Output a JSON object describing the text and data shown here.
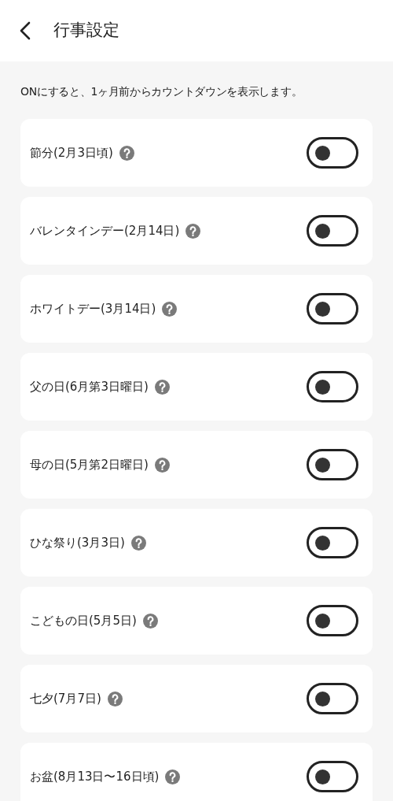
{
  "header": {
    "title": "行事設定"
  },
  "description": "ONにすると、1ヶ月前からカウントダウンを表示します。",
  "events": [
    {
      "label": "節分(2月3日頃)",
      "on": false
    },
    {
      "label": "バレンタインデー(2月14日)",
      "on": false
    },
    {
      "label": "ホワイトデー(3月14日)",
      "on": false
    },
    {
      "label": "父の日(6月第3日曜日)",
      "on": false
    },
    {
      "label": "母の日(5月第2日曜日)",
      "on": false
    },
    {
      "label": "ひな祭り(3月3日)",
      "on": false
    },
    {
      "label": "こどもの日(5月5日)",
      "on": false
    },
    {
      "label": "七夕(7月7日)",
      "on": false
    },
    {
      "label": "お盆(8月13日〜16日頃)",
      "on": false
    }
  ]
}
